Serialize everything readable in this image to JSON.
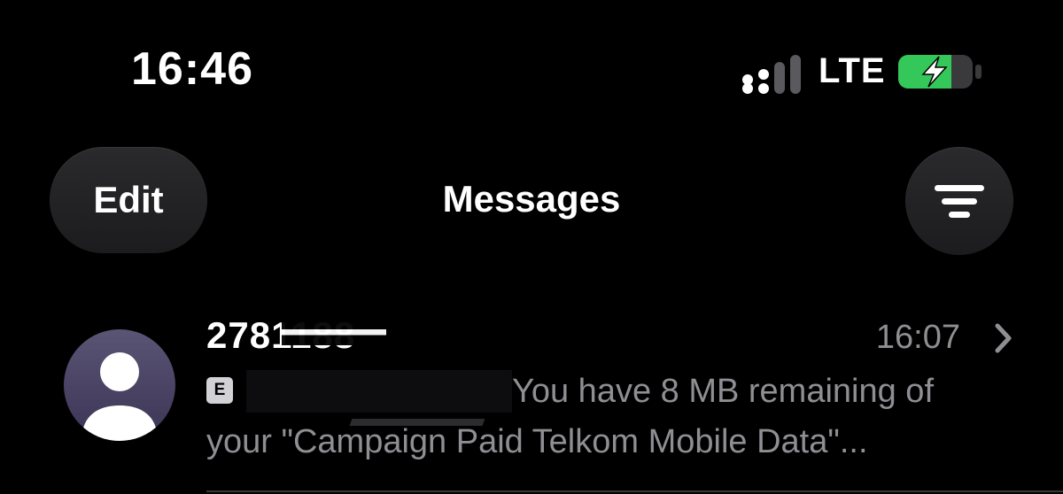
{
  "status_bar": {
    "time": "16:46",
    "network": "LTE",
    "battery_state": "charging",
    "icons": [
      "signal-icon",
      "battery-charging-icon"
    ],
    "colors": {
      "battery_fill": "#34c759"
    }
  },
  "nav": {
    "edit_label": "Edit",
    "title": "Messages",
    "filter_icon": "filter-lines-icon"
  },
  "conversations": [
    {
      "sender": "2781188",
      "time": "16:07",
      "badge": "E",
      "preview_line1": "You have 8 MB remaining of",
      "preview_line2": "your \"Campaign Paid Telkom Mobile Data\"...",
      "avatar_icon": "person-icon",
      "chevron_icon": "chevron-right-icon"
    }
  ],
  "colors": {
    "background": "#000000",
    "secondary_text": "#8e8e93",
    "button_bg": "#1c1c1e",
    "avatar_bg": "#4a4465"
  }
}
